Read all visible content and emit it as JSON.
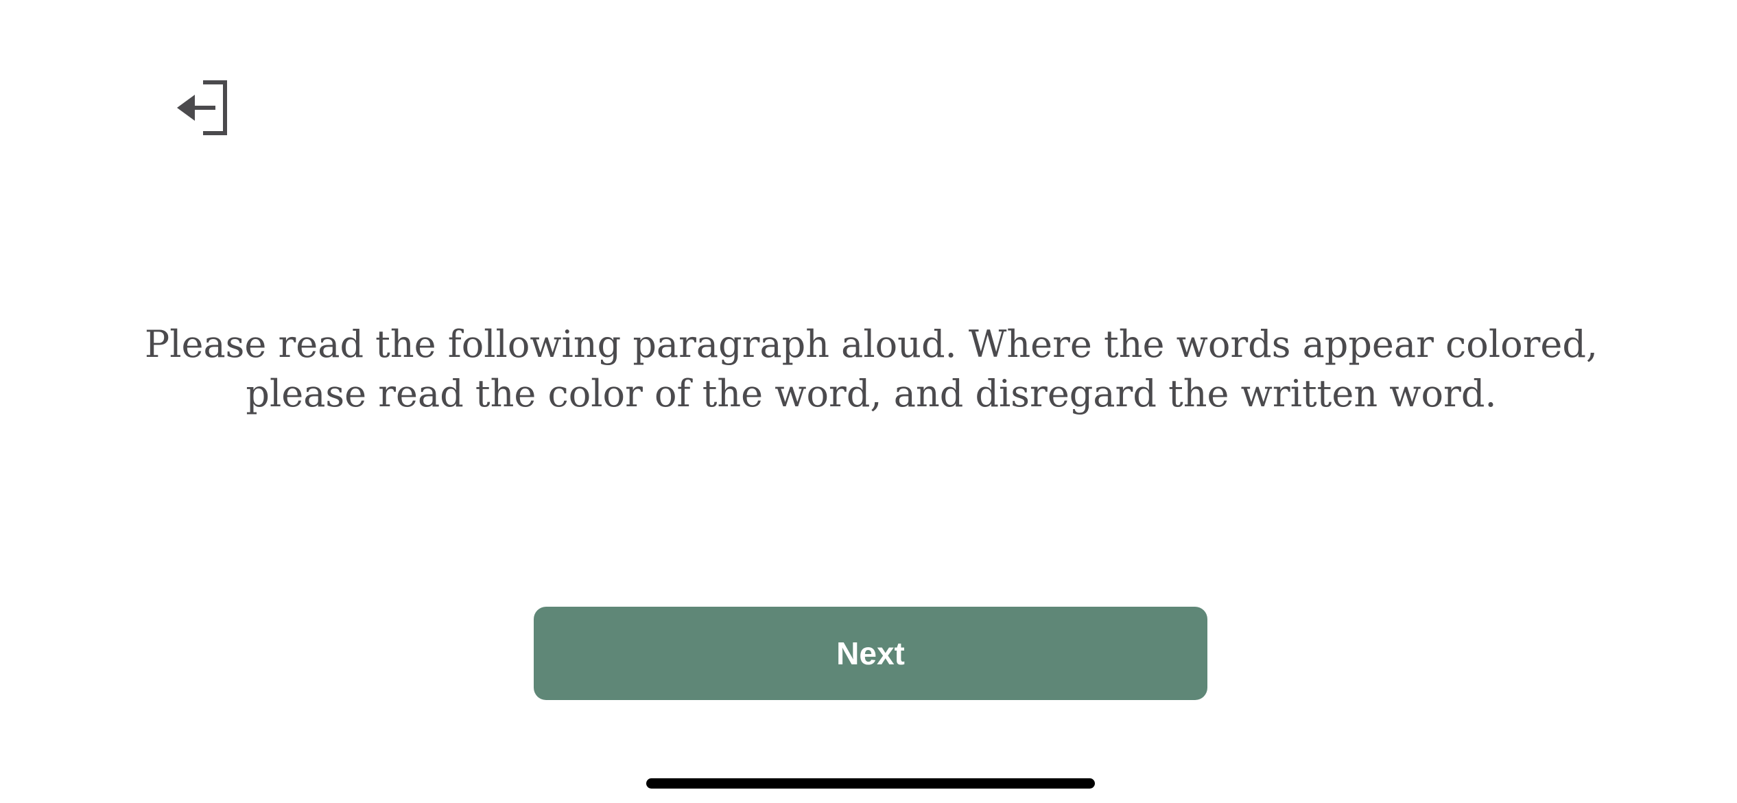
{
  "header": {
    "exit_icon": "exit-arrow-icon"
  },
  "main": {
    "instructions": "Please read the following paragraph aloud. Where the words appear colored, please read the color of the word, and disregard the written word.",
    "next_label": "Next"
  },
  "colors": {
    "accent": "#5f8777",
    "text": "#4b4a4d",
    "background": "#ffffff"
  }
}
